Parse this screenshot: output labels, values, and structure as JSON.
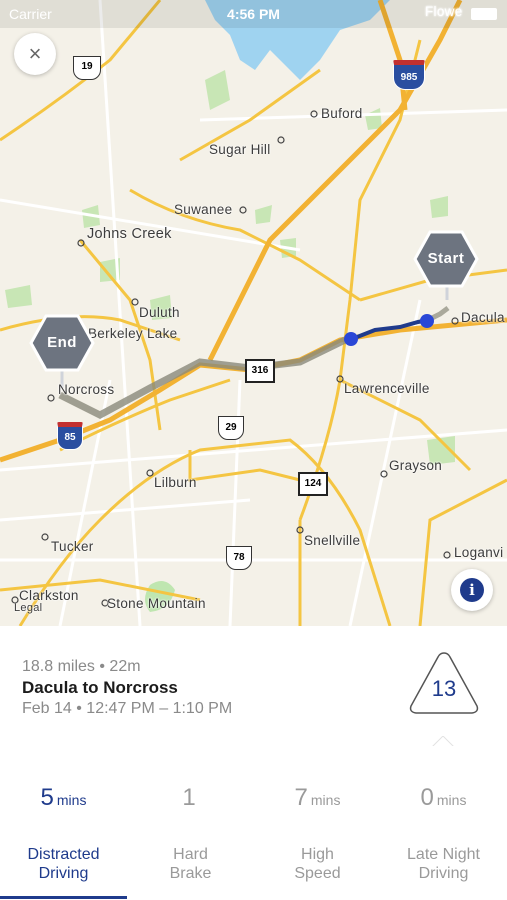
{
  "status_bar": {
    "carrier": "Carrier",
    "time": "4:56 PM"
  },
  "map": {
    "markers": {
      "start": "Start",
      "end": "End"
    },
    "places": {
      "flowery_branch": "Flowe",
      "buford": "Buford",
      "sugar_hill": "Sugar Hill",
      "suwanee": "Suwanee",
      "johns_creek": "Johns Creek",
      "duluth": "Duluth",
      "berkeley_lake": "Berkeley Lake",
      "norcross": "Norcross",
      "lawrenceville": "Lawrenceville",
      "dacula": "Dacula",
      "grayson": "Grayson",
      "lilburn": "Lilburn",
      "snellville": "Snellville",
      "tucker": "Tucker",
      "clarkston": "Clarkston",
      "stone_mountain": "Stone Mountain",
      "loganville": "Loganvi",
      "legal": "Legal"
    },
    "shields": {
      "us19": "19",
      "i985": "985",
      "sr316": "316",
      "us29": "29",
      "i85": "85",
      "sr124": "124",
      "us78": "78"
    },
    "colors": {
      "route_driven": "#1f3b8c",
      "route_past": "#8a8a7a",
      "point": "#2a47d6",
      "marker": "#6d7480"
    }
  },
  "buttons": {
    "close_glyph": "×",
    "info_glyph": "i"
  },
  "trip": {
    "distance_duration": "18.8 miles • 22m",
    "route": "Dacula to Norcross",
    "datetime": "Feb 14 • 12:47 PM – 1:10 PM",
    "score": "13"
  },
  "tabs": [
    {
      "count": "5",
      "unit": "mins",
      "line1": "Distracted",
      "line2": "Driving",
      "active": true
    },
    {
      "count": "1",
      "unit": "",
      "line1": "Hard",
      "line2": "Brake",
      "active": false
    },
    {
      "count": "7",
      "unit": "mins",
      "line1": "High",
      "line2": "Speed",
      "active": false
    },
    {
      "count": "0",
      "unit": "mins",
      "line1": "Late Night",
      "line2": "Driving",
      "active": false
    }
  ]
}
